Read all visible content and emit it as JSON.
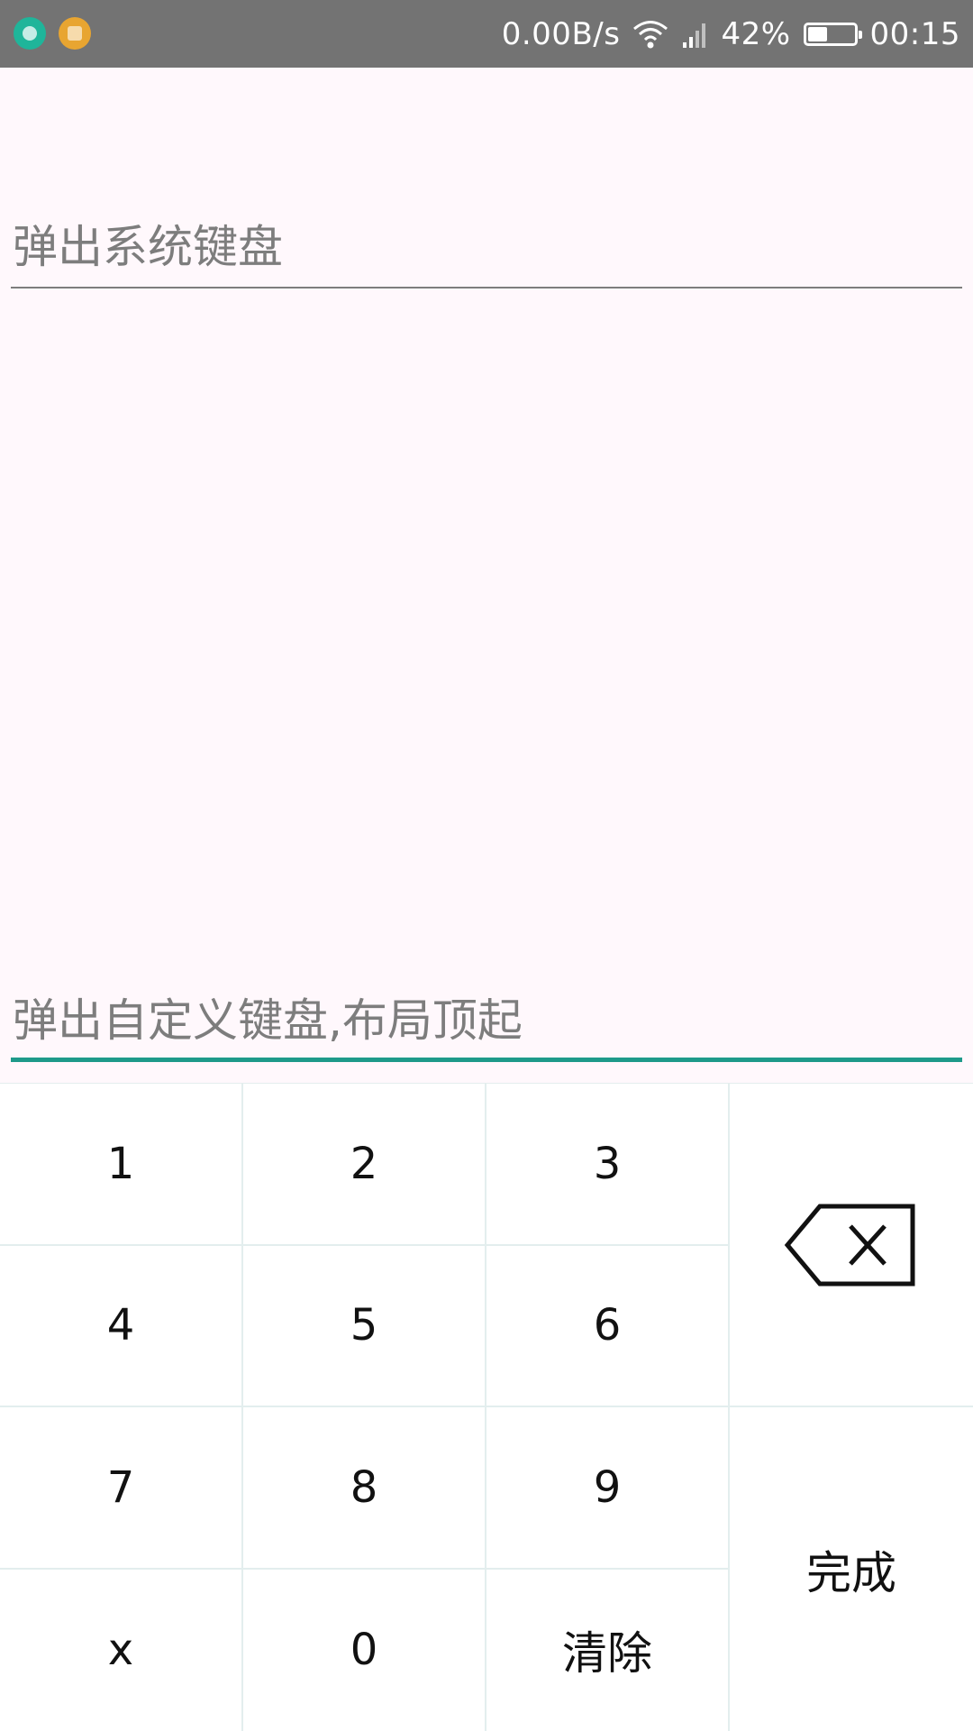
{
  "status_bar": {
    "notification_icons": [
      "emoji-app-icon",
      "slides-app-icon"
    ],
    "network_speed": "0.00B/s",
    "battery_percent": "42%",
    "battery_level": 0.42,
    "time": "00:15"
  },
  "fields": {
    "system_keyboard_placeholder": "弹出系统键盘",
    "custom_keyboard_placeholder": "弹出自定义键盘,布局顶起"
  },
  "keypad": {
    "keys": [
      "1",
      "2",
      "3",
      "4",
      "5",
      "6",
      "7",
      "8",
      "9",
      "x",
      "0",
      "清除"
    ],
    "backspace_icon": "backspace-icon",
    "done_label": "完成"
  },
  "colors": {
    "status_bar": "#737373",
    "background": "#fff8fc",
    "accent": "#1e9a8a",
    "divider": "#e3eeee"
  }
}
